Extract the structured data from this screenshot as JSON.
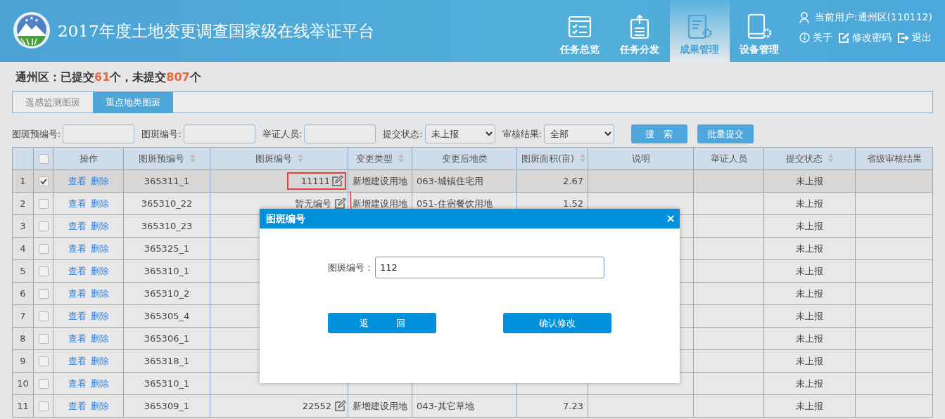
{
  "header": {
    "title": "2017年度土地变更调查国家级在线举证平台",
    "nav": [
      {
        "label": "任务总览",
        "selected": false
      },
      {
        "label": "任务分发",
        "selected": false
      },
      {
        "label": "成果管理",
        "selected": true
      },
      {
        "label": "设备管理",
        "selected": false
      }
    ],
    "user": "当前用户:通州区(110112)",
    "links": [
      "关于",
      "修改密码",
      "退出"
    ]
  },
  "summary": [
    {
      "text": "通州区：",
      "kind": "plain"
    },
    {
      "text": "已提交",
      "kind": "plain"
    },
    {
      "text": "61",
      "kind": "count"
    },
    {
      "text": "个，未提交",
      "kind": "plain"
    },
    {
      "text": "807",
      "kind": "count"
    },
    {
      "text": "个",
      "kind": "plain"
    }
  ],
  "tabs": [
    {
      "label": "遥感监测图斑",
      "selected": false
    },
    {
      "label": "重点地类图斑",
      "selected": true
    }
  ],
  "filters": [
    {
      "label": "图斑预编号:",
      "kind": "text"
    },
    {
      "label": "图斑编号:",
      "kind": "text"
    },
    {
      "label": "举证人员:",
      "kind": "text"
    },
    {
      "label": "提交状态:",
      "kind": "select",
      "value": "未上报"
    },
    {
      "label": "审核结果:",
      "kind": "select",
      "value": "全部"
    }
  ],
  "filter_buttons": [
    "搜　索",
    "批量提交"
  ],
  "table": {
    "all_checked": false,
    "columns": [
      {
        "kind": "index"
      },
      {
        "kind": "check"
      },
      {
        "label": "操作",
        "sortable": false
      },
      {
        "label": "图斑预编号",
        "sortable": true
      },
      {
        "label": "图斑编号",
        "sortable": true
      },
      {
        "label": "变更类型",
        "sortable": true
      },
      {
        "label": "变更后地类",
        "sortable": false
      },
      {
        "label": "图斑面积(亩)",
        "sortable": true
      },
      {
        "label": "说明",
        "sortable": false
      },
      {
        "label": "举证人员",
        "sortable": false
      },
      {
        "label": "提交状态",
        "sortable": true
      },
      {
        "label": "省级审核结果",
        "sortable": false
      }
    ],
    "rows": [
      {
        "index": "1",
        "checked": true,
        "selected": true,
        "actions": [
          "查看",
          "删除"
        ],
        "pre_id": "365311_1",
        "id": "11111",
        "highlighted": true,
        "change_type": "新增建设用地",
        "land_class": "063-城镇住宅用",
        "area": "2.67",
        "status": "未上报"
      },
      {
        "index": "2",
        "checked": false,
        "selected": false,
        "actions": [
          "查看",
          "删除"
        ],
        "pre_id": "365310_22",
        "id": "暂无编号",
        "highlighted": false,
        "change_type": "新增建设用地",
        "land_class": "051-住宿餐饮用地",
        "area": "1.52",
        "status": "未上报"
      },
      {
        "index": "3",
        "checked": false,
        "selected": false,
        "actions": [
          "查看",
          "删除"
        ],
        "pre_id": "365310_23",
        "highlighted": false,
        "status": "未上报"
      },
      {
        "index": "4",
        "checked": false,
        "selected": false,
        "actions": [
          "查看",
          "删除"
        ],
        "pre_id": "365325_1",
        "highlighted": false,
        "status": "未上报"
      },
      {
        "index": "5",
        "checked": false,
        "selected": false,
        "actions": [
          "查看",
          "删除"
        ],
        "pre_id": "365310_1",
        "highlighted": false,
        "status": "未上报"
      },
      {
        "index": "6",
        "checked": false,
        "selected": false,
        "actions": [
          "查看",
          "删除"
        ],
        "pre_id": "365310_2",
        "highlighted": false,
        "status": "未上报"
      },
      {
        "index": "7",
        "checked": false,
        "selected": false,
        "actions": [
          "查看",
          "删除"
        ],
        "pre_id": "365305_4",
        "highlighted": false,
        "status": "未上报"
      },
      {
        "index": "8",
        "checked": false,
        "selected": false,
        "actions": [
          "查看",
          "删除"
        ],
        "pre_id": "365306_1",
        "highlighted": false,
        "status": "未上报"
      },
      {
        "index": "9",
        "checked": false,
        "selected": false,
        "actions": [
          "查看",
          "删除"
        ],
        "pre_id": "365318_1",
        "highlighted": false,
        "status": "未上报"
      },
      {
        "index": "10",
        "checked": false,
        "selected": false,
        "actions": [
          "查看",
          "删除"
        ],
        "pre_id": "365310_1",
        "highlighted": false,
        "status": "未上报"
      },
      {
        "index": "11",
        "checked": false,
        "selected": false,
        "actions": [
          "查看",
          "删除"
        ],
        "pre_id": "365309_1",
        "id": "22552",
        "highlighted": false,
        "change_type": "新增建设用地",
        "land_class": "043-其它草地",
        "area": "7.23",
        "status": "未上报"
      }
    ]
  },
  "dialog": {
    "title": "图斑编号",
    "close": "×",
    "field_label": "图斑编号：",
    "value": "112",
    "buttons": [
      "返　　　回",
      "确认修改"
    ]
  }
}
